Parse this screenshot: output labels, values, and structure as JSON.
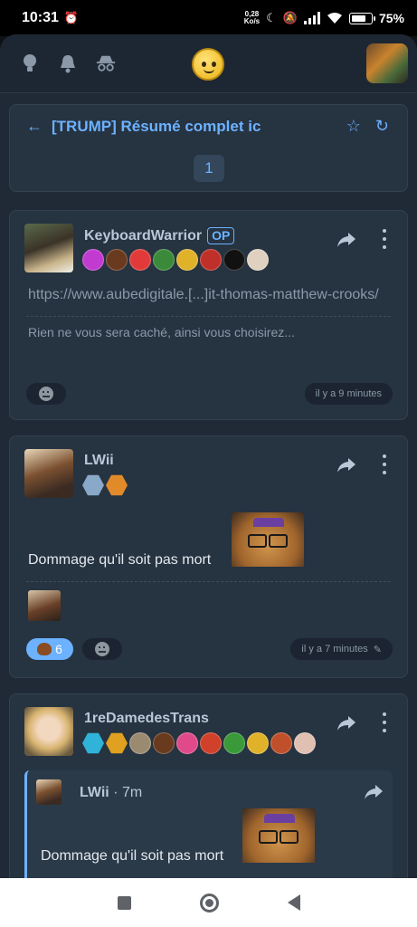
{
  "status_bar": {
    "time": "10:31",
    "net_speed_value": "0,28",
    "net_speed_unit": "Ko/s",
    "battery": "75%"
  },
  "header": {
    "icons": [
      "lightbulb-icon",
      "bell-icon",
      "incognito-icon"
    ]
  },
  "topic": {
    "title": "[TRUMP] Résumé complet ic",
    "page": "1"
  },
  "posts": [
    {
      "author": "KeyboardWarrior",
      "op_label": "OP",
      "link": "https://www.aubedigitale.[...]it-thomas-matthew-crooks/",
      "preview": "Rien ne vous sera caché, ainsi vous choisirez...",
      "timestamp": "il y a 9 minutes",
      "badge_colors": [
        "#c23bd1",
        "#6a3a1e",
        "#e23a3a",
        "#3a8a3a",
        "#e0b22a",
        "#c0302a",
        "#111111",
        "#e0d0c0"
      ]
    },
    {
      "author": "LWii",
      "text": "Dommage qu'il soit pas mort",
      "reaction_count": "6",
      "timestamp": "il y a 7 minutes",
      "badge_colors": [
        "#8aa8c8",
        "#e08a2a"
      ]
    },
    {
      "author": "1reDamedesTrans",
      "badge_colors": [
        "#2fb3d9",
        "#e0a020",
        "#9a8a70",
        "#6a3a1e",
        "#e04a8a",
        "#d0402a",
        "#3a9a3a",
        "#e0b22a",
        "#c0502a",
        "#e0c0b0"
      ],
      "quote": {
        "author": "LWii",
        "age": "· 7m",
        "text": "Dommage qu'il soit pas mort"
      }
    }
  ]
}
